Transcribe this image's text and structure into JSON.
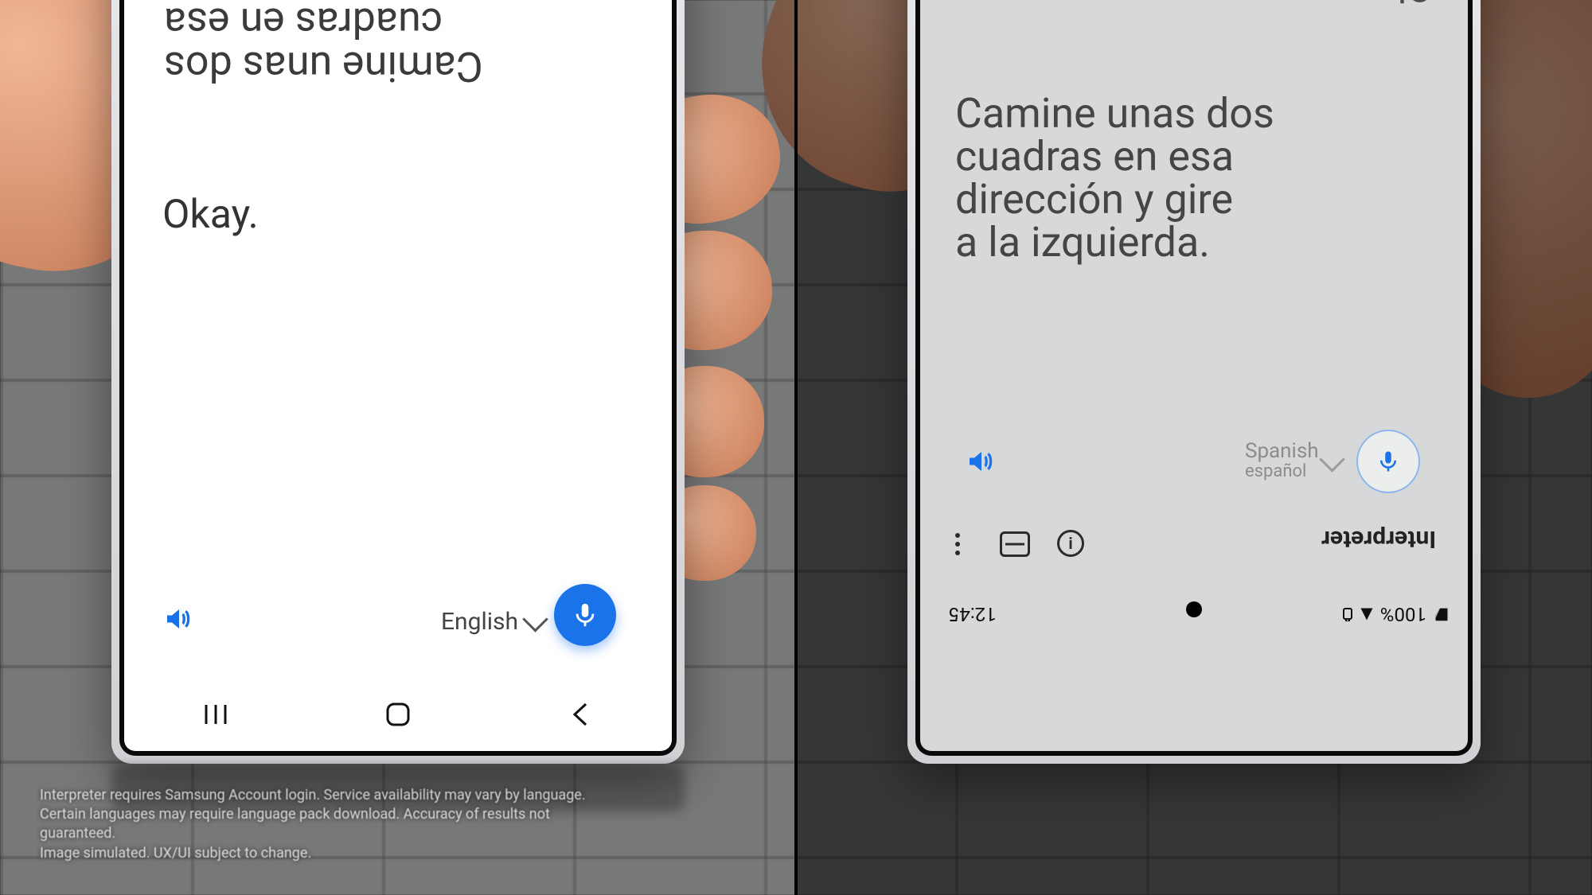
{
  "left": {
    "other_party_text_flipped": "Camine unas dos\ncuadras en esa\ndirección y gire",
    "self_text": "Okay.",
    "language_label": "English",
    "nav": {
      "recents": "|||",
      "home": "◯",
      "back": "‹"
    }
  },
  "right": {
    "other_party_text_flipped": "Okay.",
    "translation_text": "Camine unas dos\ncuadras en esa\ndirección y gire\na la izquierda.",
    "language_line1": "Spanish",
    "language_line2": "español",
    "app_title_flipped": "Interpreter",
    "status": {
      "clock": "12:45",
      "battery": "100%"
    }
  },
  "disclaimer": "Interpreter requires Samsung Account login. Service availability may vary by language.\nCertain languages may require language pack download. Accuracy of results not guaranteed.\nImage simulated. UX/UI subject to change.",
  "colors": {
    "accent": "#1a73e8"
  }
}
